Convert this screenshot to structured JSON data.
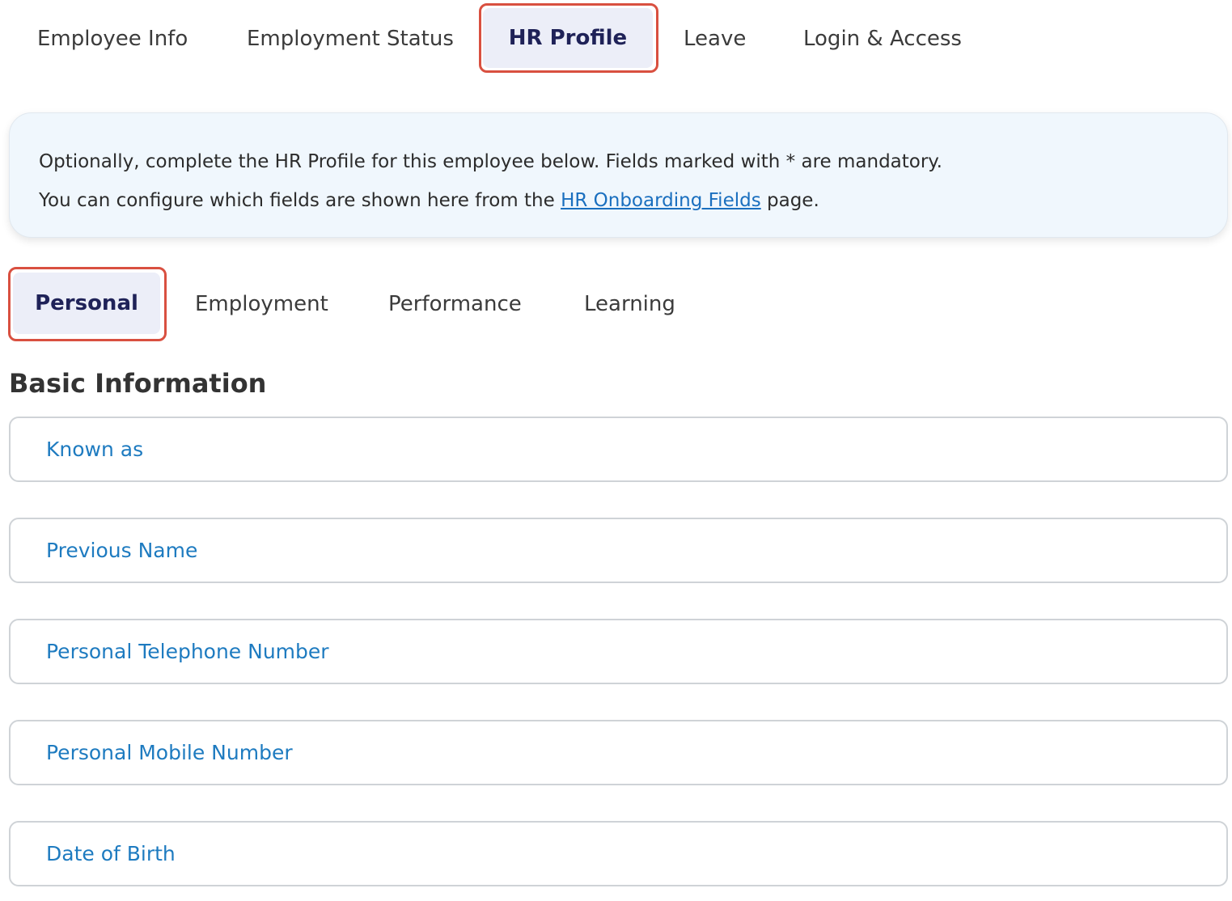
{
  "top_tabs": [
    {
      "label": "Employee Info",
      "active": false
    },
    {
      "label": "Employment Status",
      "active": false
    },
    {
      "label": "HR Profile",
      "active": true
    },
    {
      "label": "Leave",
      "active": false
    },
    {
      "label": "Login & Access",
      "active": false
    }
  ],
  "banner": {
    "line1": "Optionally, complete the HR Profile for this employee below. Fields marked with * are mandatory.",
    "line2_prefix": "You can configure which fields are shown here from the ",
    "line2_link": "HR Onboarding Fields",
    "line2_suffix": " page."
  },
  "sub_tabs": [
    {
      "label": "Personal",
      "active": true
    },
    {
      "label": "Employment",
      "active": false
    },
    {
      "label": "Performance",
      "active": false
    },
    {
      "label": "Learning",
      "active": false
    }
  ],
  "section": {
    "title": "Basic Information"
  },
  "fields": [
    {
      "label": "Known as"
    },
    {
      "label": "Previous Name"
    },
    {
      "label": "Personal Telephone Number"
    },
    {
      "label": "Personal Mobile Number"
    },
    {
      "label": "Date of Birth"
    }
  ],
  "colors": {
    "highlight": "#d95040",
    "active_tab_bg": "#eceef8",
    "active_tab_text": "#1f2258",
    "banner_bg": "#f0f7fd",
    "link": "#1a6fbf",
    "field_label": "#1e7bc0"
  }
}
